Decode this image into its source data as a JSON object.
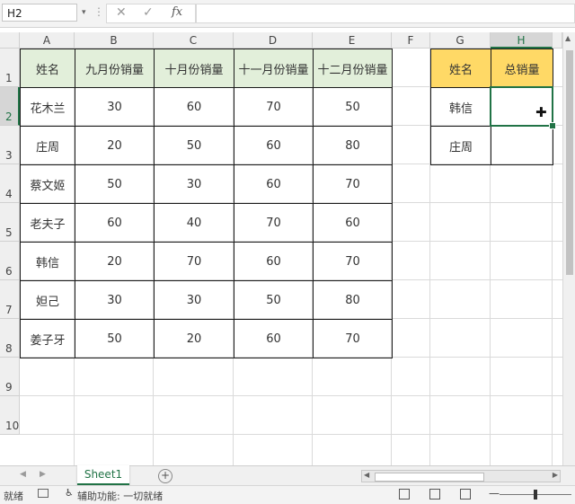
{
  "formula_bar": {
    "name_box": "H2",
    "cancel_icon": "✕",
    "enter_icon": "✓",
    "fx_label": "fx",
    "formula": ""
  },
  "columns": [
    "A",
    "B",
    "C",
    "D",
    "E",
    "F",
    "G",
    "H"
  ],
  "rows": [
    "1",
    "2",
    "3",
    "4",
    "5",
    "6",
    "7",
    "8",
    "9",
    "10"
  ],
  "selected_cell": {
    "column": "H",
    "row": "2"
  },
  "sales_table": {
    "headers": [
      "姓名",
      "九月份销量",
      "十月份销量",
      "十一月份销量",
      "十二月份销量"
    ],
    "rows": [
      [
        "花木兰",
        "30",
        "60",
        "70",
        "50"
      ],
      [
        "庄周",
        "20",
        "50",
        "60",
        "80"
      ],
      [
        "蔡文姬",
        "50",
        "30",
        "60",
        "70"
      ],
      [
        "老夫子",
        "60",
        "40",
        "70",
        "60"
      ],
      [
        "韩信",
        "20",
        "70",
        "60",
        "70"
      ],
      [
        "妲己",
        "30",
        "30",
        "50",
        "80"
      ],
      [
        "姜子牙",
        "50",
        "20",
        "60",
        "70"
      ]
    ]
  },
  "lookup_table": {
    "headers": [
      "姓名",
      "总销量"
    ],
    "rows": [
      [
        "韩信",
        ""
      ],
      [
        "庄周",
        ""
      ]
    ]
  },
  "colors": {
    "header_green": "#e2efda",
    "header_gold": "#ffd966",
    "accent": "#217346"
  },
  "sheet_tabs": {
    "active": "Sheet1",
    "add_icon": "+"
  },
  "status_bar": {
    "ready": "就绪",
    "accessibility": "辅助功能: 一切就绪"
  },
  "icons": [
    "cancel-icon",
    "enter-icon",
    "fx-icon",
    "cell-cursor-icon",
    "add-sheet-icon",
    "macro-record-icon",
    "accessibility-icon",
    "normal-view-icon",
    "page-layout-view-icon",
    "page-break-view-icon"
  ]
}
